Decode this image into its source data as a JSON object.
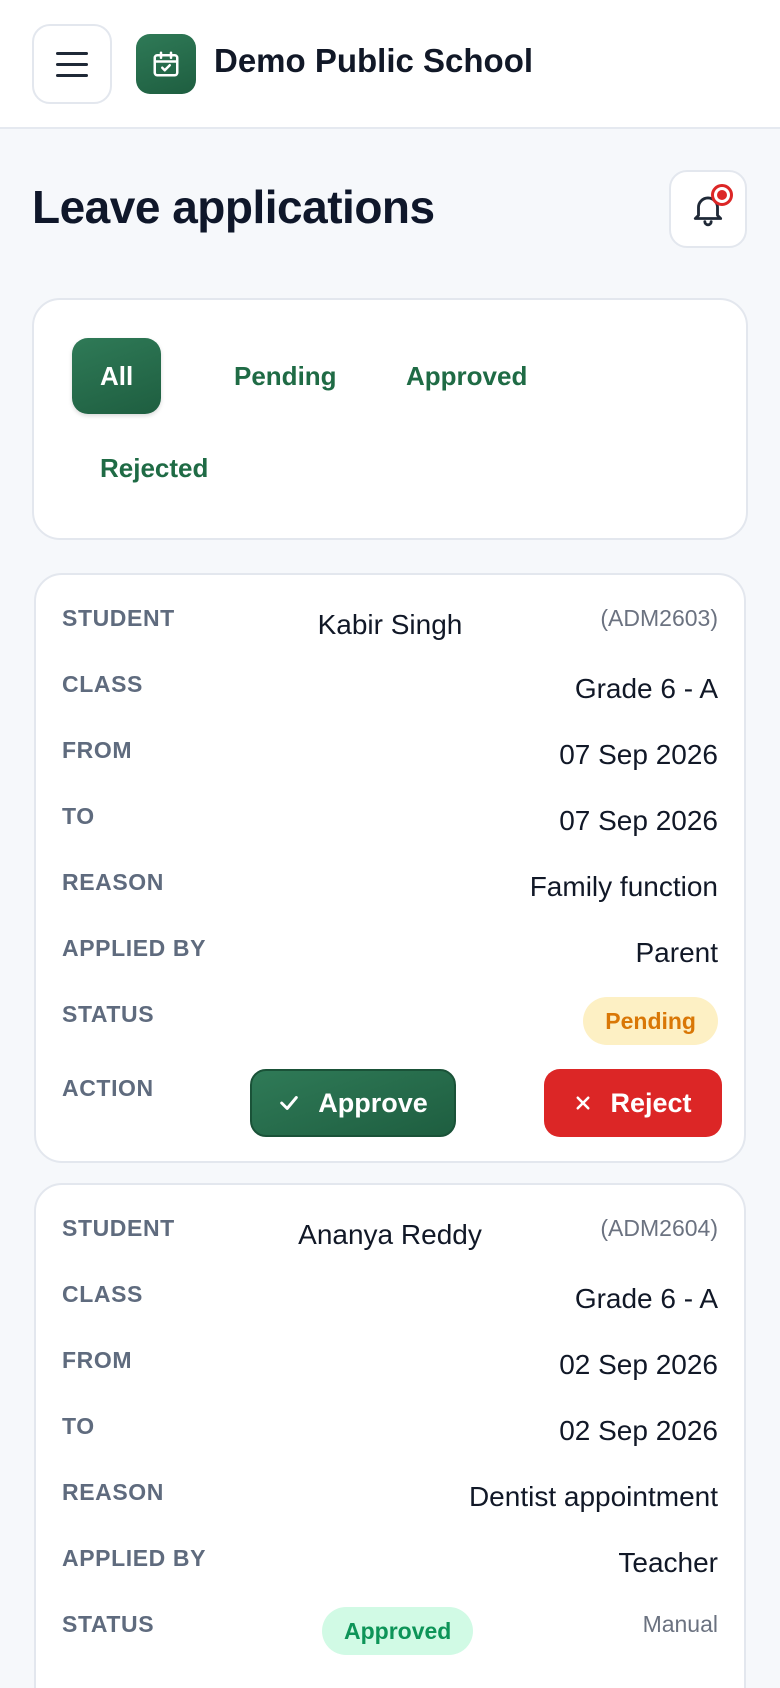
{
  "header": {
    "school_name": "Demo Public School",
    "logo_icon": "calendar-check-icon",
    "menu_icon": "hamburger-icon",
    "brand_color": "#2a6e4d"
  },
  "page": {
    "title": "Leave applications",
    "notification_icon": "bell-icon",
    "notification_indicator": true
  },
  "filters": {
    "tabs": [
      "All",
      "Pending",
      "Approved",
      "Rejected"
    ],
    "selected": "All"
  },
  "labels": {
    "student": "STUDENT",
    "class": "CLASS",
    "from": "FROM",
    "to": "TO",
    "reason": "REASON",
    "applied_by": "APPLIED BY",
    "status": "STATUS",
    "action": "ACTION"
  },
  "applications": [
    {
      "student_name": "Kabir Singh",
      "admission_no": "(ADM2603)",
      "class": "Grade 6 - A",
      "from": "07 Sep 2026",
      "to": "07 Sep 2026",
      "reason": "Family function",
      "applied_by": "Parent",
      "status": "Pending",
      "approve_label": "Approve",
      "reject_label": "Reject"
    },
    {
      "student_name": "Ananya Reddy",
      "admission_no": "(ADM2604)",
      "class": "Grade 6 - A",
      "from": "02 Sep 2026",
      "to": "02 Sep 2026",
      "reason": "Dentist appointment",
      "applied_by": "Teacher",
      "status": "Approved",
      "status_mode": "Manual"
    }
  ]
}
